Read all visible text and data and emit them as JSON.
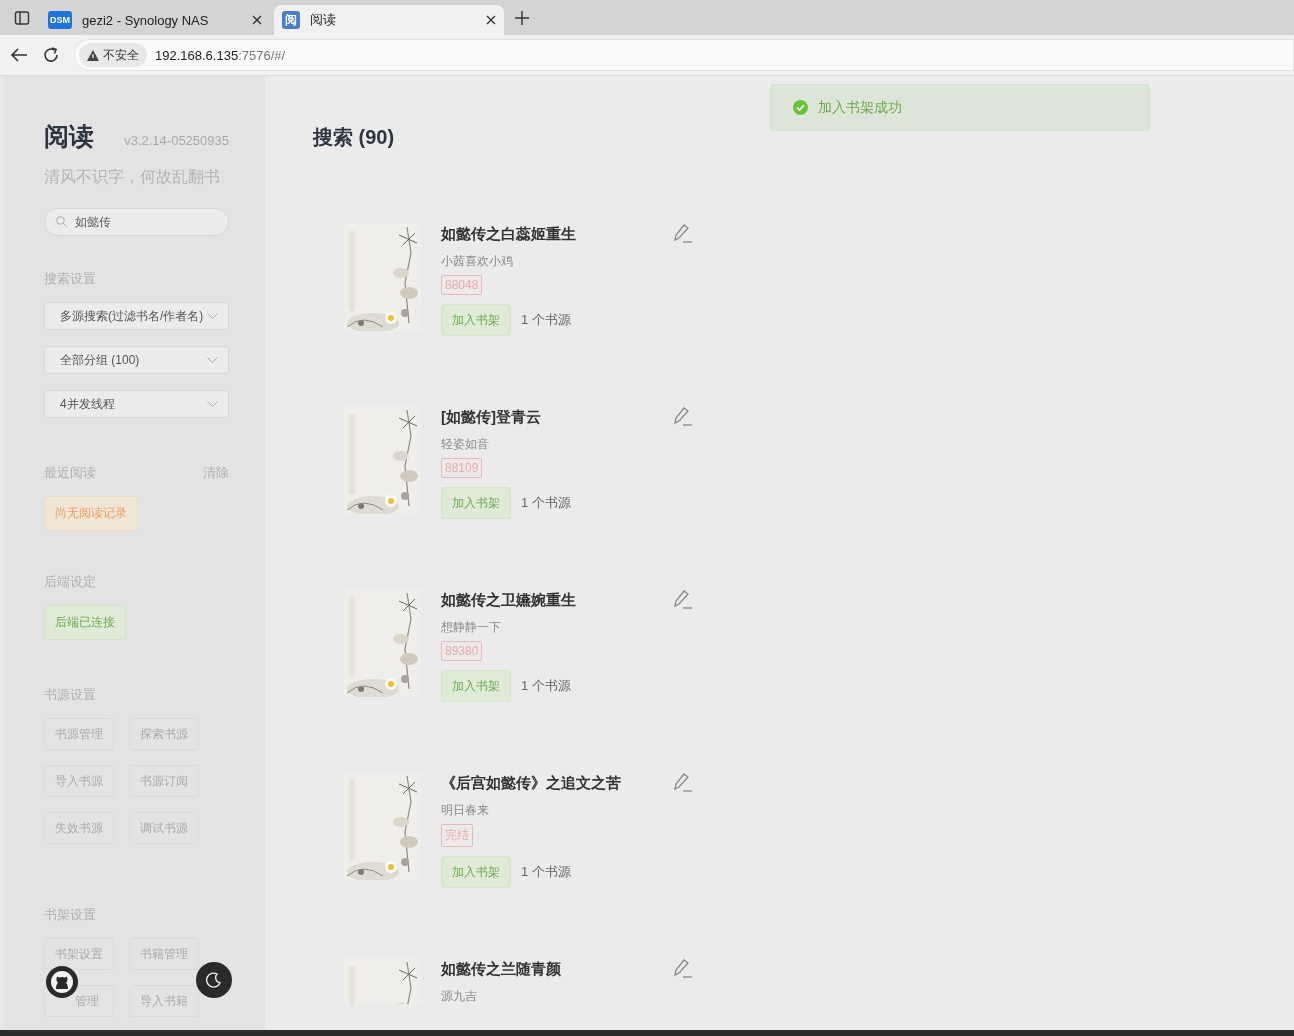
{
  "browser": {
    "tabs": [
      {
        "title": "gezi2 - Synology NAS",
        "icon": "DSM",
        "selected": false
      },
      {
        "title": "阅读",
        "icon": "阅",
        "selected": true
      }
    ],
    "security": "不安全",
    "url_host": "192.168.6.135",
    "url_rest": ":7576/#/"
  },
  "sidebar": {
    "title": "阅读",
    "version": "v3.2.14-05250935",
    "motto": "清风不识字，何故乱翻书",
    "search": "如懿传",
    "search_settings": {
      "label": "搜索设置",
      "selects": [
        "多源搜索(过滤书名/作者名)",
        "全部分组 (100)",
        "4并发线程"
      ]
    },
    "recent": {
      "label": "最近阅读",
      "clear": "清除",
      "empty": "尚无阅读记录"
    },
    "backend": {
      "label": "后端设定",
      "status": "后端已连接",
      "connected": true
    },
    "source_settings": {
      "label": "书源设置",
      "buttons": [
        "书源管理",
        "探索书源",
        "导入书源",
        "书源订阅",
        "失效书源",
        "调试书源"
      ]
    },
    "shelf_settings": {
      "label": "书架设置",
      "buttons": [
        "书架设置",
        "书籍管理",
        "管理",
        "导入书籍"
      ]
    }
  },
  "main": {
    "title": "搜索 (90)",
    "toast": "加入书架成功",
    "books": [
      {
        "title": "如懿传之白蕊姬重生",
        "author": "小茜喜欢小鸡",
        "tag": "88048",
        "add": "加入书架",
        "sources": "1 个书源"
      },
      {
        "title": "[如懿传]登青云",
        "author": "轻姿如音",
        "tag": "88109",
        "add": "加入书架",
        "sources": "1 个书源"
      },
      {
        "title": "如懿传之卫嬿婉重生",
        "author": "想静静一下",
        "tag": "89380",
        "add": "加入书架",
        "sources": "1 个书源"
      },
      {
        "title": "《后宫如懿传》之追文之苦",
        "author": "明日春来",
        "tag": "完结",
        "add": "加入书架",
        "sources": "1 个书源"
      },
      {
        "title": "如懿传之兰随青颜",
        "author": "源九吉"
      }
    ]
  }
}
